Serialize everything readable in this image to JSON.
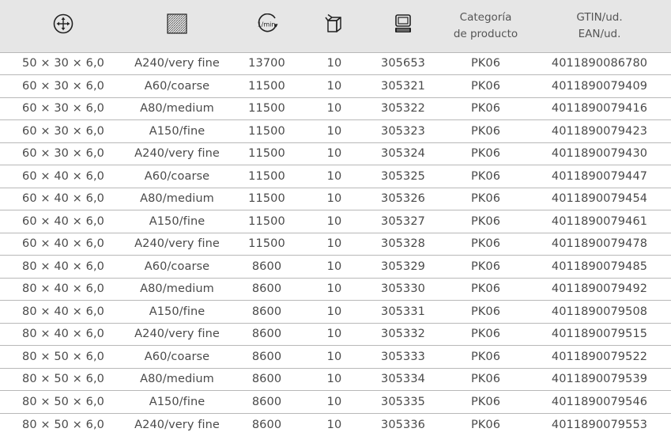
{
  "header": {
    "col0_icon": "dimensions-arrows-icon",
    "col1_icon": "grit-texture-icon",
    "col2_icon": "speed-rpm-icon",
    "col2_icon_text": "1/min",
    "col3_icon": "package-box-icon",
    "col4_icon": "computer-terminal-icon",
    "col5_line1": "Categoría",
    "col5_line2": "de producto",
    "col6_line1": "GTIN/ud.",
    "col6_line2": "EAN/ud."
  },
  "rows": [
    {
      "dim": "50 × 30 × 6,0",
      "grit": "A240/very fine",
      "rpm": "13700",
      "qty": "10",
      "art": "305653",
      "cat": "PK06",
      "ean": "4011890086780"
    },
    {
      "dim": "60 × 30 × 6,0",
      "grit": "A60/coarse",
      "rpm": "11500",
      "qty": "10",
      "art": "305321",
      "cat": "PK06",
      "ean": "4011890079409"
    },
    {
      "dim": "60 × 30 × 6,0",
      "grit": "A80/medium",
      "rpm": "11500",
      "qty": "10",
      "art": "305322",
      "cat": "PK06",
      "ean": "4011890079416"
    },
    {
      "dim": "60 × 30 × 6,0",
      "grit": "A150/fine",
      "rpm": "11500",
      "qty": "10",
      "art": "305323",
      "cat": "PK06",
      "ean": "4011890079423"
    },
    {
      "dim": "60 × 30 × 6,0",
      "grit": "A240/very fine",
      "rpm": "11500",
      "qty": "10",
      "art": "305324",
      "cat": "PK06",
      "ean": "4011890079430"
    },
    {
      "dim": "60 × 40 × 6,0",
      "grit": "A60/coarse",
      "rpm": "11500",
      "qty": "10",
      "art": "305325",
      "cat": "PK06",
      "ean": "4011890079447"
    },
    {
      "dim": "60 × 40 × 6,0",
      "grit": "A80/medium",
      "rpm": "11500",
      "qty": "10",
      "art": "305326",
      "cat": "PK06",
      "ean": "4011890079454"
    },
    {
      "dim": "60 × 40 × 6,0",
      "grit": "A150/fine",
      "rpm": "11500",
      "qty": "10",
      "art": "305327",
      "cat": "PK06",
      "ean": "4011890079461"
    },
    {
      "dim": "60 × 40 × 6,0",
      "grit": "A240/very fine",
      "rpm": "11500",
      "qty": "10",
      "art": "305328",
      "cat": "PK06",
      "ean": "4011890079478"
    },
    {
      "dim": "80 × 40 × 6,0",
      "grit": "A60/coarse",
      "rpm": "8600",
      "qty": "10",
      "art": "305329",
      "cat": "PK06",
      "ean": "4011890079485"
    },
    {
      "dim": "80 × 40 × 6,0",
      "grit": "A80/medium",
      "rpm": "8600",
      "qty": "10",
      "art": "305330",
      "cat": "PK06",
      "ean": "4011890079492"
    },
    {
      "dim": "80 × 40 × 6,0",
      "grit": "A150/fine",
      "rpm": "8600",
      "qty": "10",
      "art": "305331",
      "cat": "PK06",
      "ean": "4011890079508"
    },
    {
      "dim": "80 × 40 × 6,0",
      "grit": "A240/very fine",
      "rpm": "8600",
      "qty": "10",
      "art": "305332",
      "cat": "PK06",
      "ean": "4011890079515"
    },
    {
      "dim": "80 × 50 × 6,0",
      "grit": "A60/coarse",
      "rpm": "8600",
      "qty": "10",
      "art": "305333",
      "cat": "PK06",
      "ean": "4011890079522"
    },
    {
      "dim": "80 × 50 × 6,0",
      "grit": "A80/medium",
      "rpm": "8600",
      "qty": "10",
      "art": "305334",
      "cat": "PK06",
      "ean": "4011890079539"
    },
    {
      "dim": "80 × 50 × 6,0",
      "grit": "A150/fine",
      "rpm": "8600",
      "qty": "10",
      "art": "305335",
      "cat": "PK06",
      "ean": "4011890079546"
    },
    {
      "dim": "80 × 50 × 6,0",
      "grit": "A240/very fine",
      "rpm": "8600",
      "qty": "10",
      "art": "305336",
      "cat": "PK06",
      "ean": "4011890079553"
    }
  ]
}
